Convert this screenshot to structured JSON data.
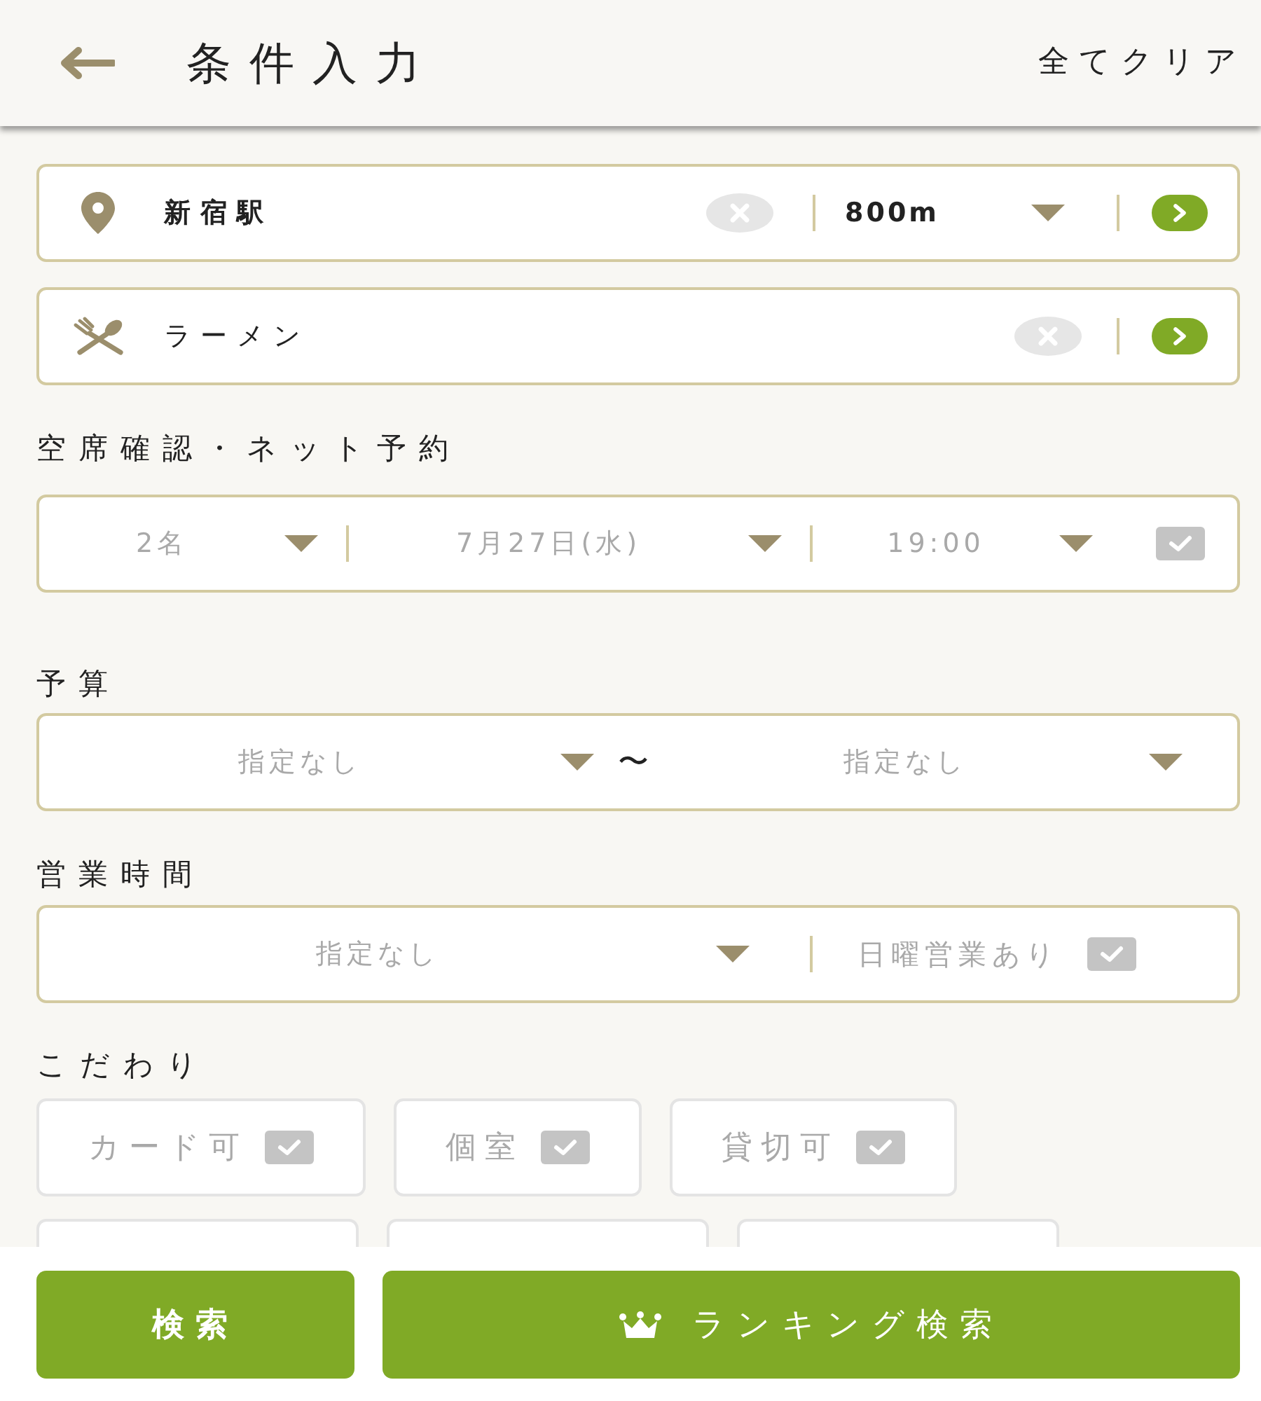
{
  "header": {
    "title": "条件入力",
    "clear_all": "全てクリア"
  },
  "location": {
    "station": "新宿駅",
    "distance": "800m"
  },
  "genre": {
    "value": "ラーメン"
  },
  "reservation": {
    "heading": "空席確認・ネット予約",
    "people": "2名",
    "date": "7月27日(水)",
    "time": "19:00",
    "checked": false
  },
  "budget": {
    "heading": "予算",
    "min": "指定なし",
    "separator": "〜",
    "max": "指定なし"
  },
  "business_hours": {
    "heading": "営業時間",
    "value": "指定なし",
    "sunday": {
      "label": "日曜営業あり",
      "checked": false
    }
  },
  "preferences": {
    "heading": "こだわり",
    "chips": [
      {
        "kind": "option",
        "label": "カード可",
        "checked": false
      },
      {
        "kind": "option",
        "label": "個室",
        "checked": false
      },
      {
        "kind": "option",
        "label": "貸切可",
        "checked": false
      },
      {
        "kind": "covered"
      },
      {
        "kind": "covered"
      },
      {
        "kind": "covered"
      }
    ]
  },
  "actions": {
    "search": "検索",
    "ranking_search": "ランキング検索"
  }
}
